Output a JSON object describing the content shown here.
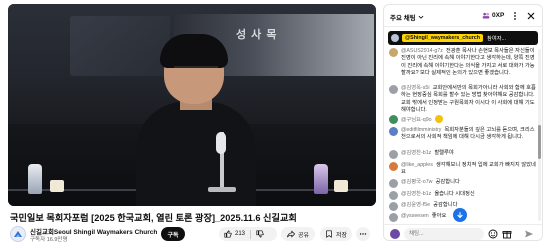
{
  "video": {
    "title": "국민일보 목회자포럼 [2025 한국교회, 열린 토론 광장]_2025.11.6 신길교회",
    "banner_text": "성 사 목"
  },
  "channel": {
    "name": "신길교회Seoul Shingil Waymakers Church",
    "subscribers": "구독자 16.9만명",
    "subscribe_label": "구독"
  },
  "actions": {
    "like_count": "213",
    "share_label": "공유",
    "save_label": "저장"
  },
  "chat": {
    "tab_label": "주요 채팅",
    "viewer_count": "0XP",
    "pinned": {
      "user": "@Shingil_waymakers_church",
      "text": "참여자..."
    },
    "messages": [
      {
        "user": "@ASUS2914-g7z",
        "text": "전광훈 목사나 손현보 목사들은 자신들이 진영이 아닌 진리에 속해 이야기한다고 생각하는데, 양쪽 진영이 진리에 속해 이야기한다는 의식을 가지고 서로 대화가 가능할까요? 보다 실제적인 논의가 있으면 좋겠습니다."
      },
      {
        "user": "@김영옥-s5i",
        "text": "교회안에서만의 목회가아니라 사회와 함께 호흡하는 현장중심 목회를 할수 있는 방법 찾아야해요 공감합니다. 교회 밖에서 인정받는 구원목회자 이시다 이 사회에 대해 기도해야합니다."
      },
      {
        "user": "@구님요-q9o",
        "text": ""
      },
      {
        "user": "@editfilmministry",
        "text": "목회자분들의 깊은 고뇌를 듣으며, 크리스천으로서의 사회적 책임에 대해 다시금 생각하게 됩니다."
      },
      {
        "user": "@김영찬-b1z",
        "text": "할렐루야"
      },
      {
        "user": "@like_apples",
        "text": "생각해보니 정치적 입에 교회가 빠지지 않았네요"
      },
      {
        "user": "@김평국-o7w",
        "text": "공감합니다"
      },
      {
        "user": "@김영찬-b1z",
        "text": "옳습니다 시대정신"
      },
      {
        "user": "@김윤영-f5e",
        "text": "공감합니다"
      },
      {
        "user": "@ysseesen",
        "text": "좋아요"
      }
    ],
    "input_placeholder": "채팅..."
  },
  "colors": {
    "pinned_user_bg": "#ffd400",
    "jump_button": "#1a73e8",
    "subscribe_bg": "#0f0f0f"
  },
  "icons": [
    "channel-logo-icon",
    "thumbs-up-icon",
    "thumbs-down-icon",
    "share-icon",
    "save-icon",
    "more-icon",
    "chevron-down-icon",
    "viewers-icon",
    "menu-icon",
    "close-icon",
    "arrow-down-icon",
    "emoji-icon",
    "gift-icon",
    "send-icon"
  ]
}
